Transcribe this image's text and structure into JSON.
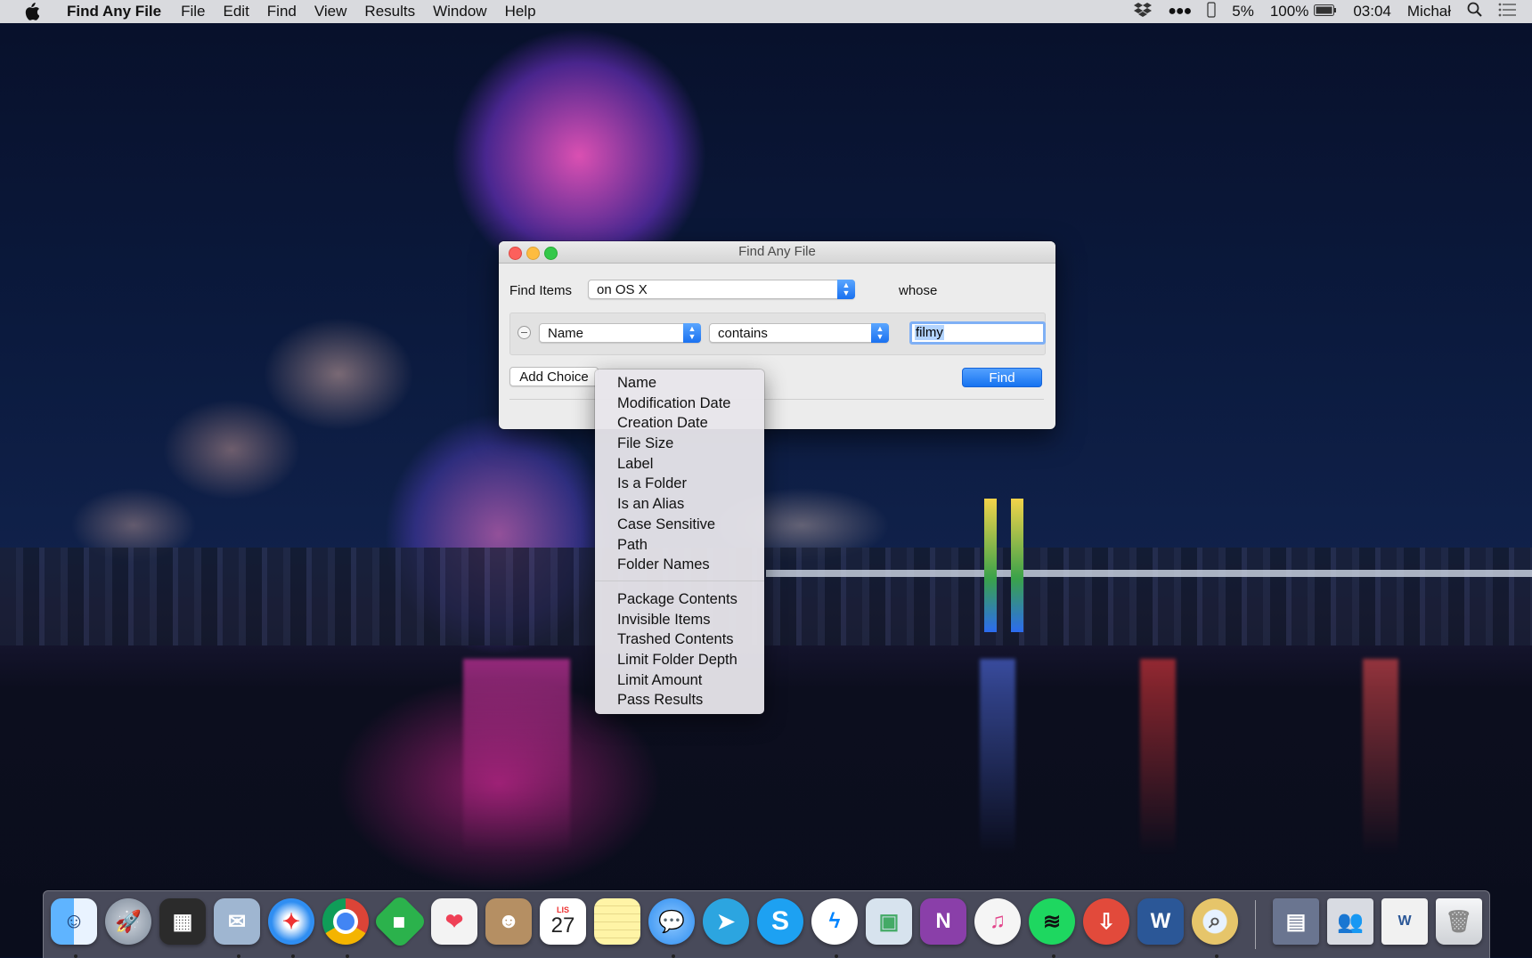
{
  "menubar": {
    "app_name": "Find Any File",
    "items": [
      "File",
      "Edit",
      "Find",
      "View",
      "Results",
      "Window",
      "Help"
    ],
    "status": {
      "battery_small": "5%",
      "battery": "100%",
      "time": "03:04",
      "user": "Michał"
    }
  },
  "window": {
    "title": "Find Any File",
    "find_items_label": "Find Items",
    "location_value": "on OS X",
    "whose_label": "whose",
    "criterion": {
      "field": "Name",
      "operator": "contains",
      "value": "filmy"
    },
    "add_choice_label": "Add Choice",
    "find_button": "Find"
  },
  "dropdown": {
    "group1": [
      "Name",
      "Modification Date",
      "Creation Date",
      "File Size",
      "Label",
      "Is a Folder",
      "Is an Alias",
      "Case Sensitive",
      "Path",
      "Folder Names"
    ],
    "group2": [
      "Package Contents",
      "Invisible Items",
      "Trashed Contents",
      "Limit Folder Depth",
      "Limit Amount",
      "Pass Results"
    ]
  },
  "dock": {
    "calendar_month": "LIS",
    "calendar_day": "27",
    "apps": [
      {
        "name": "finder-icon",
        "color": "#3d8ff0"
      },
      {
        "name": "launchpad-icon",
        "color": "#8a9aab"
      },
      {
        "name": "mission-control-icon",
        "color": "#2b2b2b"
      },
      {
        "name": "mail-icon",
        "color": "#9fb6d1"
      },
      {
        "name": "safari-icon",
        "color": "#2f8ef2"
      },
      {
        "name": "chrome-icon",
        "color": "#e8e8e8"
      },
      {
        "name": "feedly-icon",
        "color": "#2bb24c"
      },
      {
        "name": "pocket-icon",
        "color": "#f3f3f3"
      },
      {
        "name": "contacts-icon",
        "color": "#b58f63"
      },
      {
        "name": "calendar-icon",
        "color": "#ffffff"
      },
      {
        "name": "notes-icon",
        "color": "#fff4a6"
      },
      {
        "name": "messages-icon",
        "color": "#4aa4ff"
      },
      {
        "name": "telegram-icon",
        "color": "#2ca5e0"
      },
      {
        "name": "skype-icon",
        "color": "#1da1f2"
      },
      {
        "name": "messenger-icon",
        "color": "#ffffff"
      },
      {
        "name": "preview-icon",
        "color": "#d7e3ee"
      },
      {
        "name": "onenote-icon",
        "color": "#8a3fa9"
      },
      {
        "name": "itunes-icon",
        "color": "#f5f5f5"
      },
      {
        "name": "spotify-icon",
        "color": "#1ed760"
      },
      {
        "name": "transmit-icon",
        "color": "#e24a3b"
      },
      {
        "name": "word-icon",
        "color": "#2b5797"
      },
      {
        "name": "find-any-file-icon",
        "color": "#e6c56a"
      }
    ],
    "right_items": [
      {
        "name": "downloads-stack-icon",
        "color": "#6a7590"
      },
      {
        "name": "documents-stack-icon",
        "color": "#d8dbe2"
      },
      {
        "name": "word-doc-stack-icon",
        "color": "#f1f1f1"
      },
      {
        "name": "trash-icon",
        "color": "#e9eaec"
      }
    ]
  }
}
